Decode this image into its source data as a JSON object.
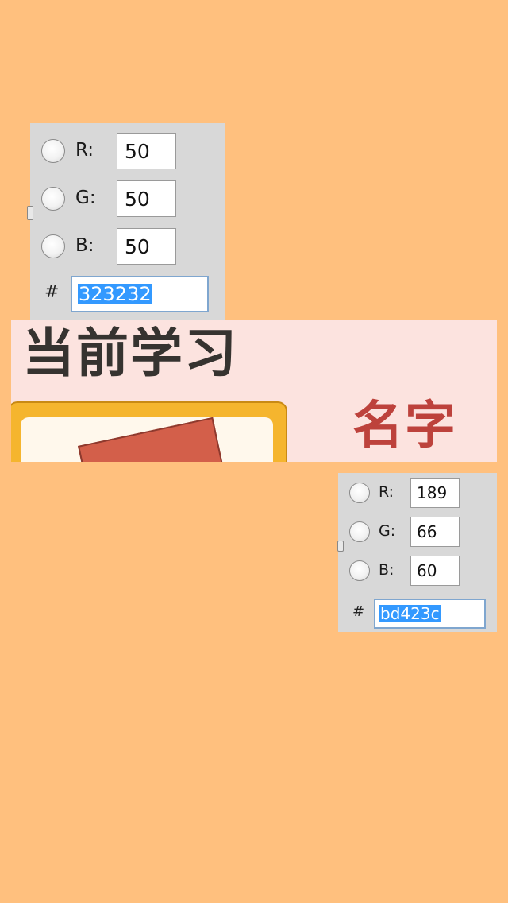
{
  "picker_top": {
    "channels": [
      {
        "label": "R:",
        "value": "50"
      },
      {
        "label": "G:",
        "value": "50"
      },
      {
        "label": "B:",
        "value": "50"
      }
    ],
    "hash_label": "#",
    "hex_value": "323232"
  },
  "banner": {
    "title": "当前学习",
    "name": "名字"
  },
  "picker_bottom": {
    "channels": [
      {
        "label": "R:",
        "value": "189"
      },
      {
        "label": "G:",
        "value": "66"
      },
      {
        "label": "B:",
        "value": "60"
      }
    ],
    "hash_label": "#",
    "hex_value": "bd423c"
  },
  "colors": {
    "background": "#FFC07E",
    "panel": "#D8D8D8",
    "banner_bg": "#FCE3DF",
    "title_text": "#363330",
    "name_text": "#BD423C",
    "selection": "#3399FF"
  }
}
